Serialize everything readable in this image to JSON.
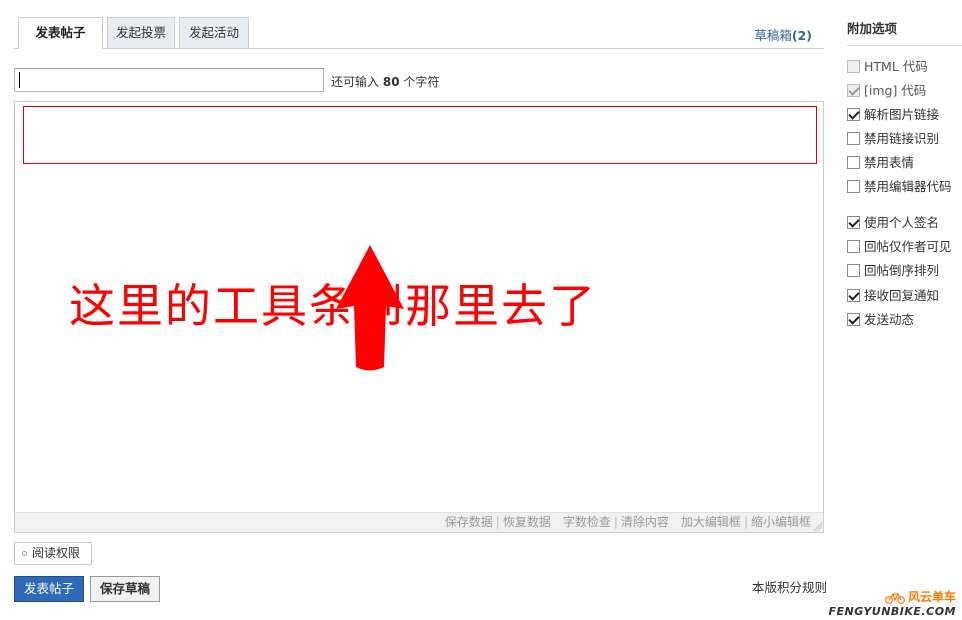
{
  "tabs": [
    {
      "label": "发表帖子"
    },
    {
      "label": "发起投票"
    },
    {
      "label": "发起活动"
    }
  ],
  "drafts": {
    "label": "草稿箱",
    "count": "(2)"
  },
  "title_field": {
    "value": "",
    "hint_prefix": "还可输入",
    "hint_count": "80",
    "hint_suffix": "个字符"
  },
  "editor": {
    "annotation": "这里的工具条到那里去了",
    "annotation_color": "#ff0000",
    "footer_links": [
      "保存数据",
      "恢复数据",
      "字数检查",
      "清除内容",
      "加大编辑框",
      "缩小编辑框"
    ]
  },
  "read_permission": {
    "label": "阅读权限"
  },
  "buttons": {
    "post": "发表帖子",
    "save_draft": "保存草稿"
  },
  "rules_link": "本版积分规则",
  "sidebar": {
    "title": "附加选项",
    "options": [
      {
        "label": "HTML 代码",
        "checked": false,
        "disabled": true
      },
      {
        "label": "[img] 代码",
        "checked": true,
        "disabled": true
      },
      {
        "label": "解析图片链接",
        "checked": true,
        "disabled": false
      },
      {
        "label": "禁用链接识别",
        "checked": false,
        "disabled": false
      },
      {
        "label": "禁用表情",
        "checked": false,
        "disabled": false
      },
      {
        "label": "禁用编辑器代码",
        "checked": false,
        "disabled": false
      },
      {
        "label": "使用个人签名",
        "checked": true,
        "disabled": false
      },
      {
        "label": "回帖仅作者可见",
        "checked": false,
        "disabled": false
      },
      {
        "label": "回帖倒序排列",
        "checked": false,
        "disabled": false
      },
      {
        "label": "接收回复通知",
        "checked": true,
        "disabled": false
      },
      {
        "label": "发送动态",
        "checked": true,
        "disabled": false
      }
    ]
  },
  "logo": {
    "cn": "风云单车",
    "en": "FENGYUNBIKE.COM",
    "brand_color": "#ff7a00"
  },
  "colors": {
    "accent": "#2d6ab8",
    "link": "#336699"
  }
}
